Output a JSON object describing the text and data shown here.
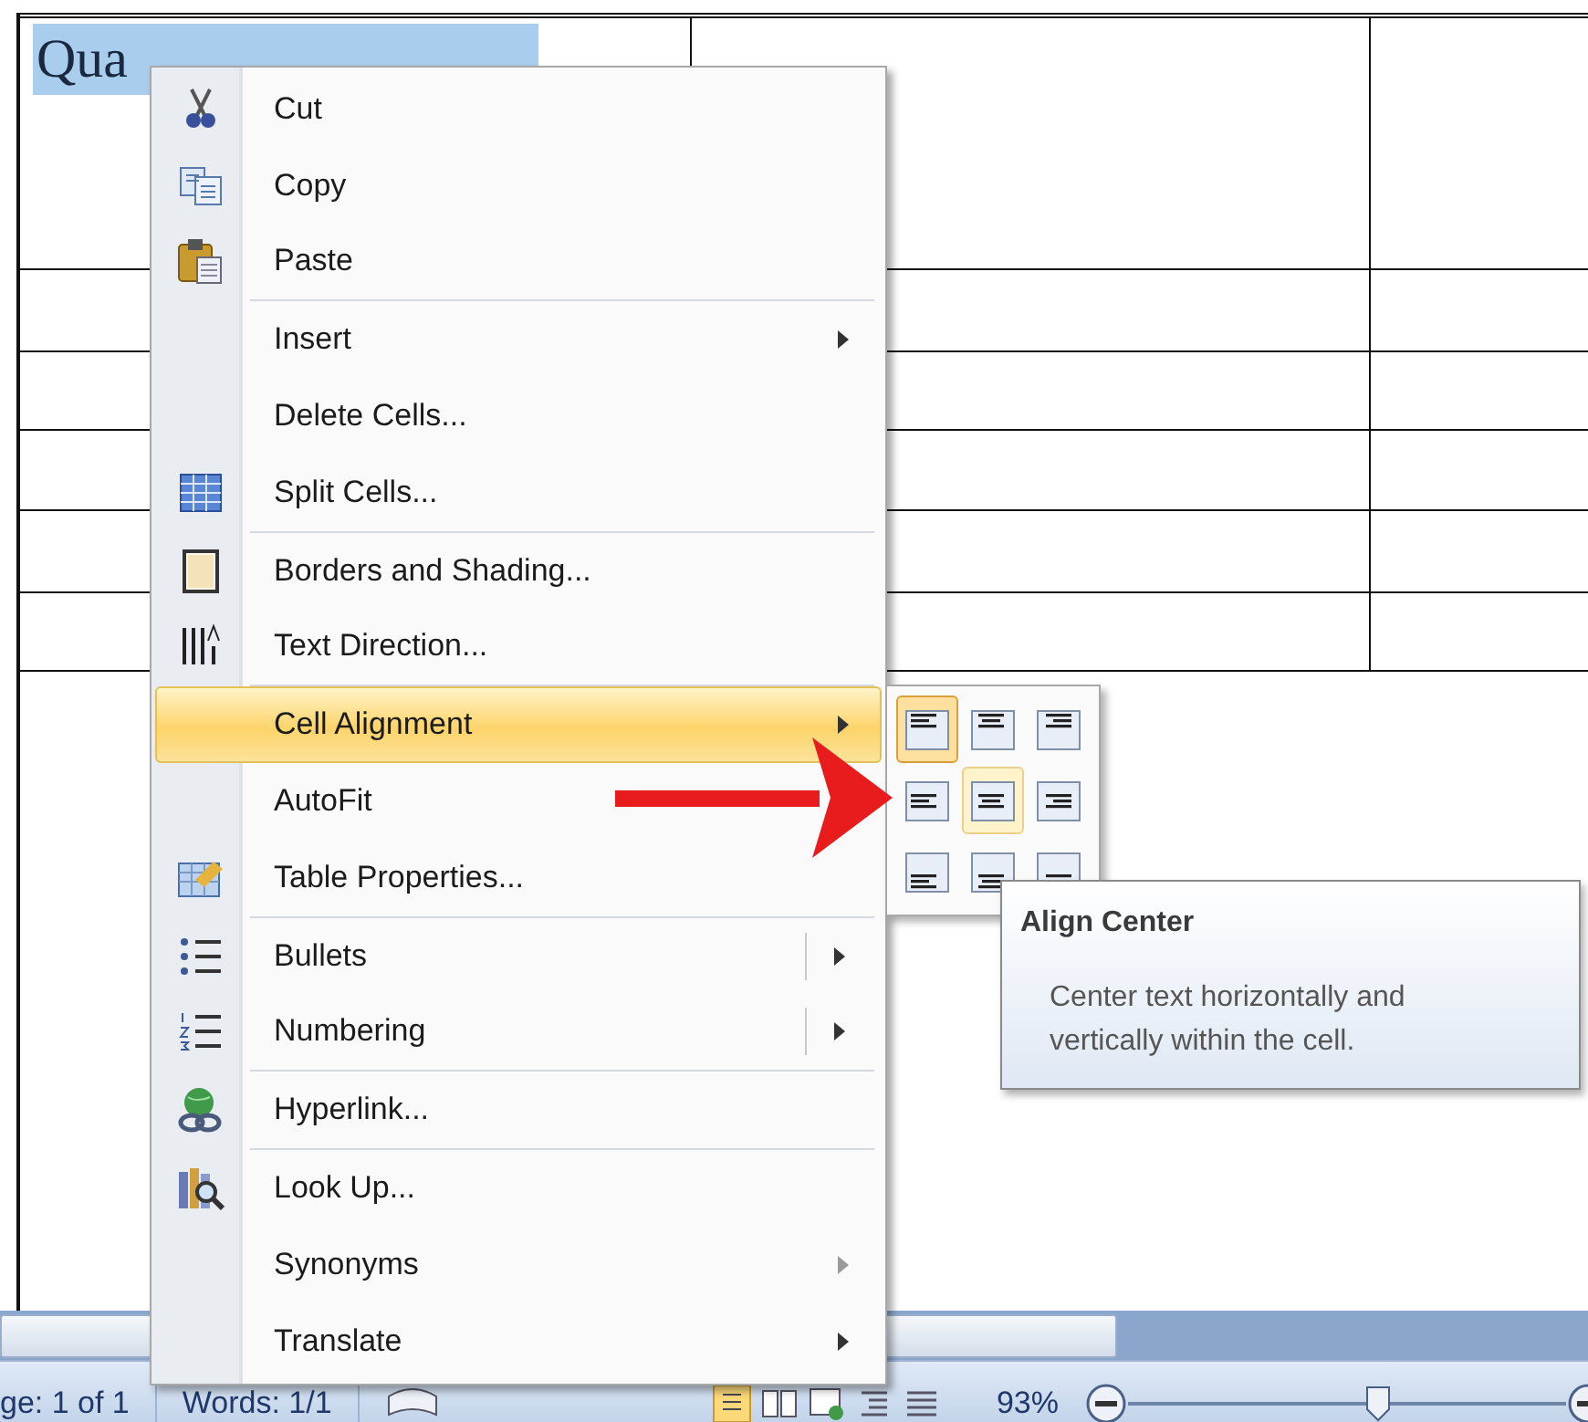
{
  "document": {
    "selected_text": "Qua"
  },
  "context_menu": {
    "groups": [
      [
        {
          "label": "Cut",
          "kind": "plain",
          "selected": false
        },
        {
          "label": "Copy",
          "kind": "plain",
          "selected": false
        },
        {
          "label": "Paste",
          "kind": "plain",
          "selected": false
        }
      ],
      [
        {
          "label": "Insert",
          "kind": "submenu",
          "selected": false
        },
        {
          "label": "Delete Cells...",
          "kind": "plain",
          "selected": false
        },
        {
          "label": "Split Cells...",
          "kind": "plain",
          "selected": false
        }
      ],
      [
        {
          "label": "Borders and Shading...",
          "kind": "plain",
          "selected": false
        },
        {
          "label": "Text Direction...",
          "kind": "plain",
          "selected": false
        }
      ],
      [
        {
          "label": "Cell Alignment",
          "kind": "submenu",
          "selected": true
        },
        {
          "label": "AutoFit",
          "kind": "plain",
          "selected": false
        },
        {
          "label": "Table Properties...",
          "kind": "plain",
          "selected": false
        }
      ],
      [
        {
          "label": "Bullets",
          "kind": "split",
          "selected": false
        },
        {
          "label": "Numbering",
          "kind": "split",
          "selected": false
        }
      ],
      [
        {
          "label": "Hyperlink...",
          "kind": "plain",
          "selected": false
        }
      ],
      [
        {
          "label": "Look Up...",
          "kind": "plain",
          "selected": false
        },
        {
          "label": "Synonyms",
          "kind": "dimmed",
          "selected": false
        },
        {
          "label": "Translate",
          "kind": "submenu",
          "selected": false
        }
      ]
    ]
  },
  "align_palette": {
    "buttons": [
      {
        "kind": "top-left",
        "selected": true,
        "hovered": false
      },
      {
        "kind": "top-center",
        "selected": false,
        "hovered": false
      },
      {
        "kind": "top-right",
        "selected": false,
        "hovered": false
      },
      {
        "kind": "middle-left",
        "selected": false,
        "hovered": false
      },
      {
        "kind": "middle-center",
        "selected": false,
        "hovered": true
      },
      {
        "kind": "middle-right",
        "selected": false,
        "hovered": false
      },
      {
        "kind": "bottom-left",
        "selected": false,
        "hovered": false
      },
      {
        "kind": "bottom-center",
        "selected": false,
        "hovered": false
      },
      {
        "kind": "bottom-right",
        "selected": false,
        "hovered": false
      }
    ]
  },
  "tooltip": {
    "title": "Align Center",
    "description": "Center text horizontally and vertically within the cell."
  },
  "status_bar": {
    "page": "ge: 1 of 1",
    "words": "Words: 1/1",
    "zoom": "93%",
    "zoom_slider": {
      "level": 0.57
    }
  }
}
